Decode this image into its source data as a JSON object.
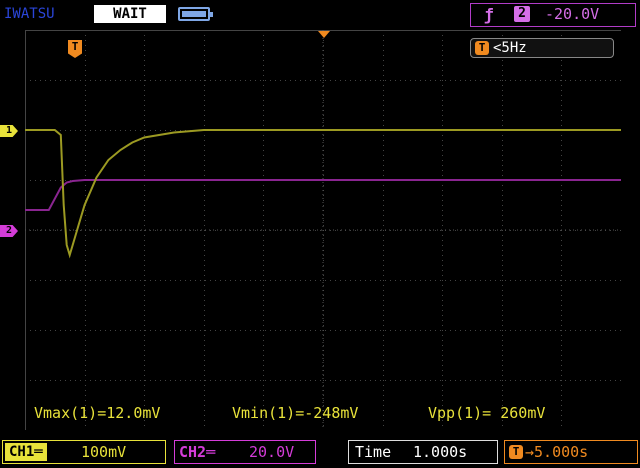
{
  "header": {
    "brand": "IWATSU",
    "acq_state": "WAIT",
    "trigger": {
      "slope_glyph": "ƒ",
      "source": "2",
      "level": "-20.0V"
    }
  },
  "frequency": {
    "icon": "T",
    "value": "<5Hz"
  },
  "markers": {
    "ch1": "1",
    "ch2": "2",
    "trigger_pos": "T"
  },
  "measurements": [
    {
      "label": "Vmax(1)=12.0mV"
    },
    {
      "label": "Vmin(1)=-248mV"
    },
    {
      "label": "Vpp(1)= 260mV"
    }
  ],
  "footer": {
    "ch1": {
      "tag": "CH1═",
      "scale": "100mV"
    },
    "ch2": {
      "tag": "CH2═",
      "scale": "20.0V"
    },
    "time": {
      "label": "Time",
      "value": "1.000s"
    },
    "delay": {
      "icon": "T",
      "value": "→5.000s"
    }
  },
  "colors": {
    "ch1": "#e8e23a",
    "ch1_trace": "#9c9a22",
    "ch2": "#d43cd8",
    "ch2_trace": "#8a2590",
    "trigger": "#f08a20",
    "brand": "#2a45d8"
  },
  "chart_data": {
    "type": "line",
    "grid": true,
    "series": [
      {
        "x": [
          0,
          0.5,
          0.6,
          0.65,
          0.7,
          0.75,
          0.8,
          0.9,
          1.0,
          1.2,
          1.4,
          1.6,
          1.8,
          2.0,
          2.5,
          3.0,
          4.0,
          5.0,
          6.0,
          7.0,
          8.0,
          9.0,
          10.0
        ],
        "y": [
          0.0,
          0.0,
          -0.1,
          -1.5,
          -2.3,
          -2.5,
          -2.3,
          -1.9,
          -1.5,
          -0.95,
          -0.6,
          -0.4,
          -0.25,
          -0.15,
          -0.05,
          0.0,
          0.0,
          0.0,
          0.0,
          0.0,
          0.0,
          0.0,
          0.0
        ]
      },
      {
        "x": [
          0,
          0.4,
          0.6,
          0.7,
          0.8,
          1.0,
          1.3,
          2.0,
          3.0,
          4.0,
          5.0,
          6.0,
          7.0,
          8.0,
          9.0,
          10.0
        ],
        "y": [
          -0.6,
          -0.6,
          -0.15,
          -0.05,
          -0.02,
          0.0,
          0.0,
          0.0,
          0.0,
          0.0,
          0.0,
          0.0,
          0.0,
          0.0,
          0.0,
          0.0
        ]
      }
    ],
    "xlim": [
      0,
      10
    ],
    "ylim": [
      -4,
      4
    ]
  }
}
